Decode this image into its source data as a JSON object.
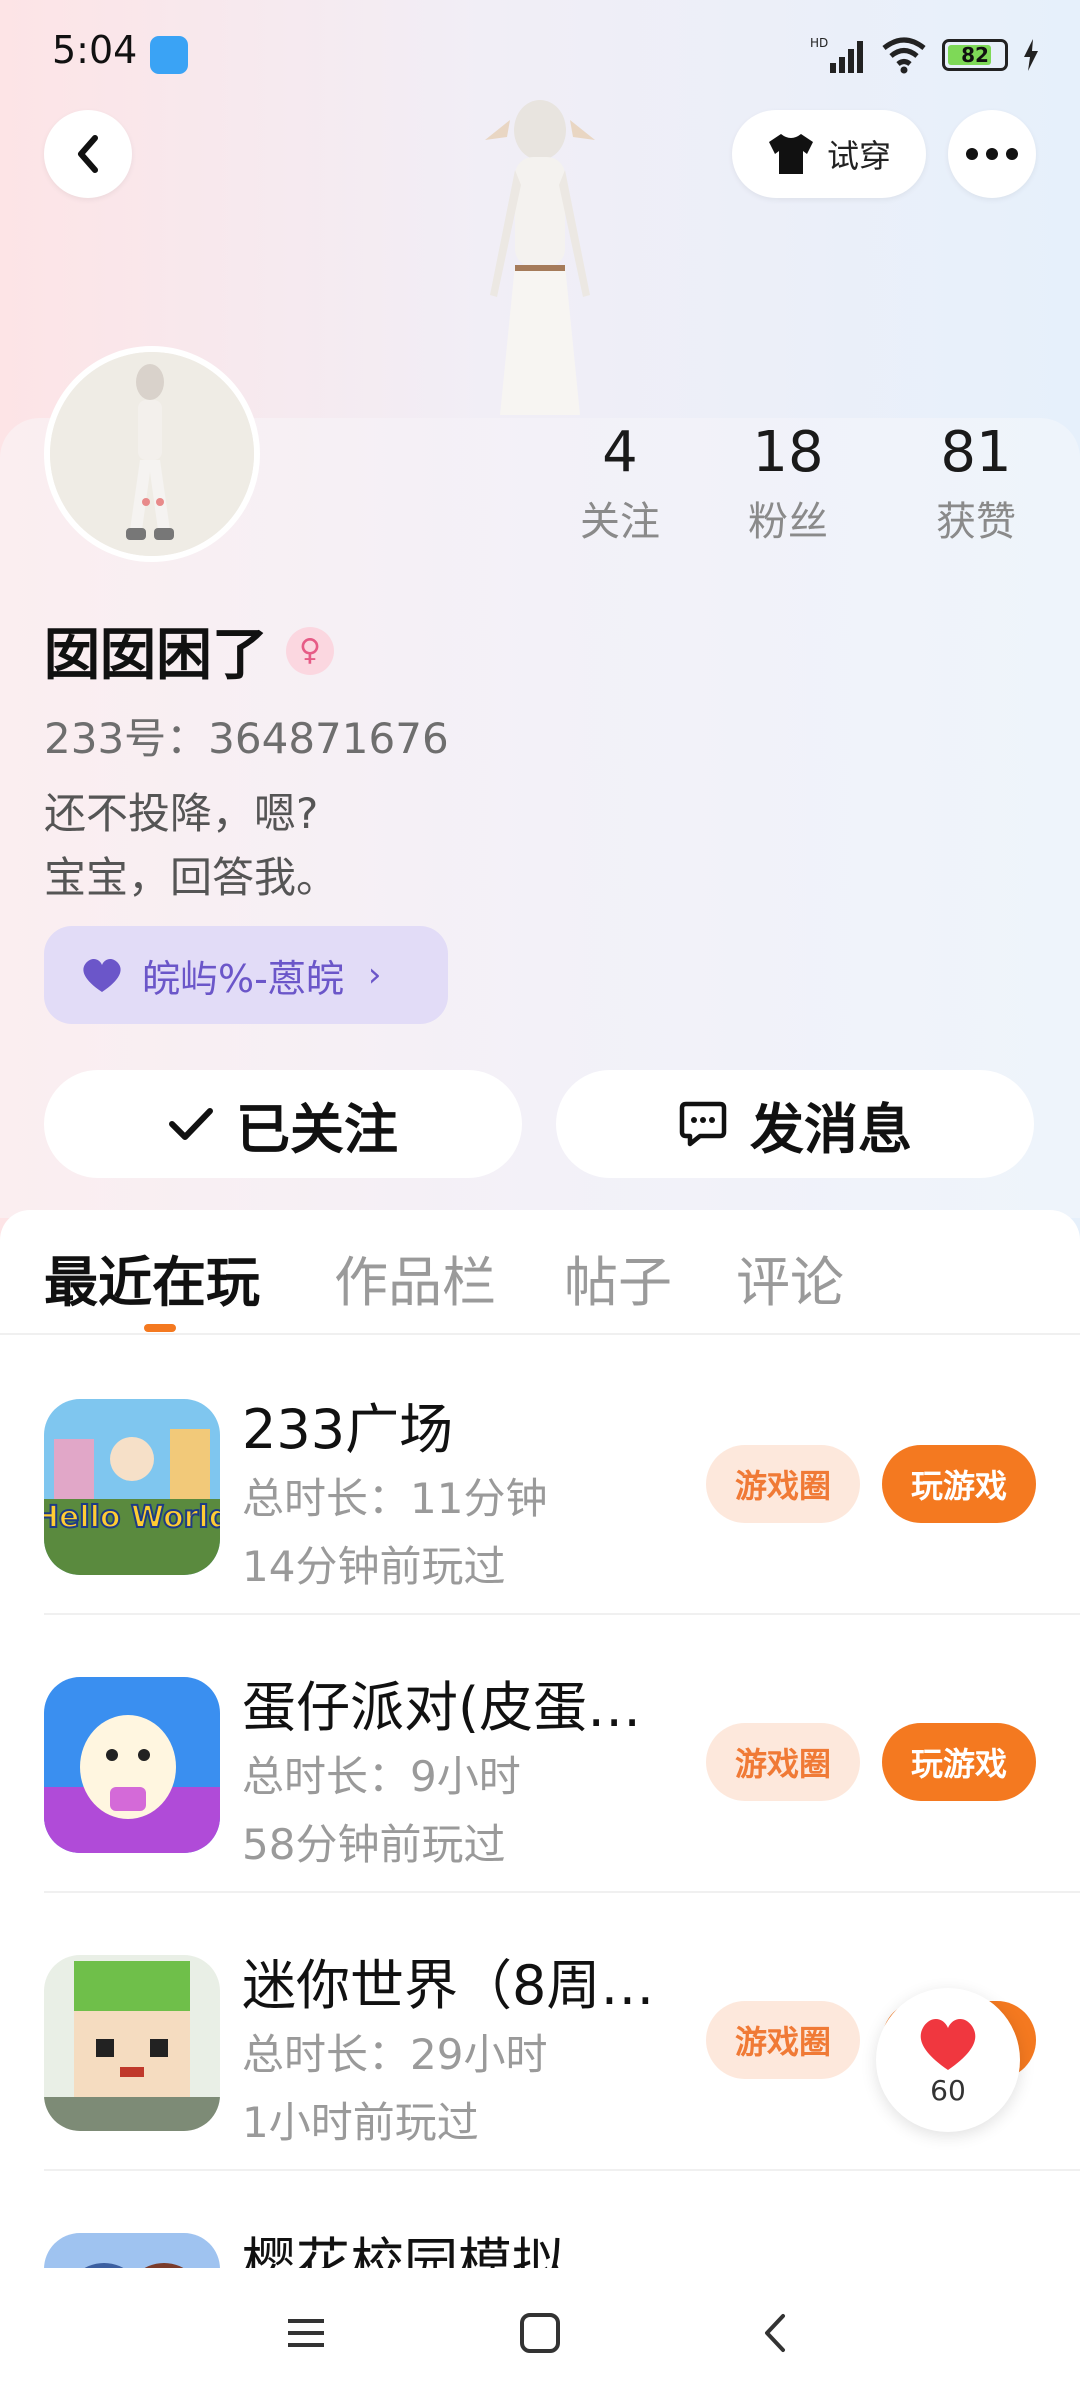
{
  "status_bar": {
    "time": "5:04",
    "network_label": "HD",
    "battery_level": "82"
  },
  "header": {
    "tryon_label": "试穿"
  },
  "profile": {
    "stats": [
      {
        "value": "4",
        "label": "关注"
      },
      {
        "value": "18",
        "label": "粉丝"
      },
      {
        "value": "81",
        "label": "获赞"
      }
    ],
    "nickname": "囡囡困了",
    "uid": "233号：364871676",
    "bio_lines": [
      "还不投降，嗯?",
      "宝宝，回答我。"
    ],
    "family_tag": "皖屿%-蒽皖",
    "follow_label": "已关注",
    "message_label": "发消息"
  },
  "tabs": [
    "最近在玩",
    "作品栏",
    "帖子",
    "评论"
  ],
  "games": [
    {
      "title": "233广场",
      "duration": "总时长：11分钟",
      "last_played": "14分钟前玩过",
      "circle_label": "游戏圈",
      "play_label": "玩游戏",
      "icon_text": "Hello World"
    },
    {
      "title": "蛋仔派对(皮蛋…",
      "duration": "总时长：9小时",
      "last_played": "58分钟前玩过",
      "circle_label": "游戏圈",
      "play_label": "玩游戏"
    },
    {
      "title": "迷你世界（8周…",
      "duration": "总时长：29小时",
      "last_played": "1小时前玩过",
      "circle_label": "游戏圈",
      "play_label": "玩游戏"
    },
    {
      "title": "樱花校园模拟…"
    }
  ],
  "like_float": {
    "count": "60"
  },
  "colors": {
    "accent": "#f47920",
    "family": "#6b56c9"
  }
}
